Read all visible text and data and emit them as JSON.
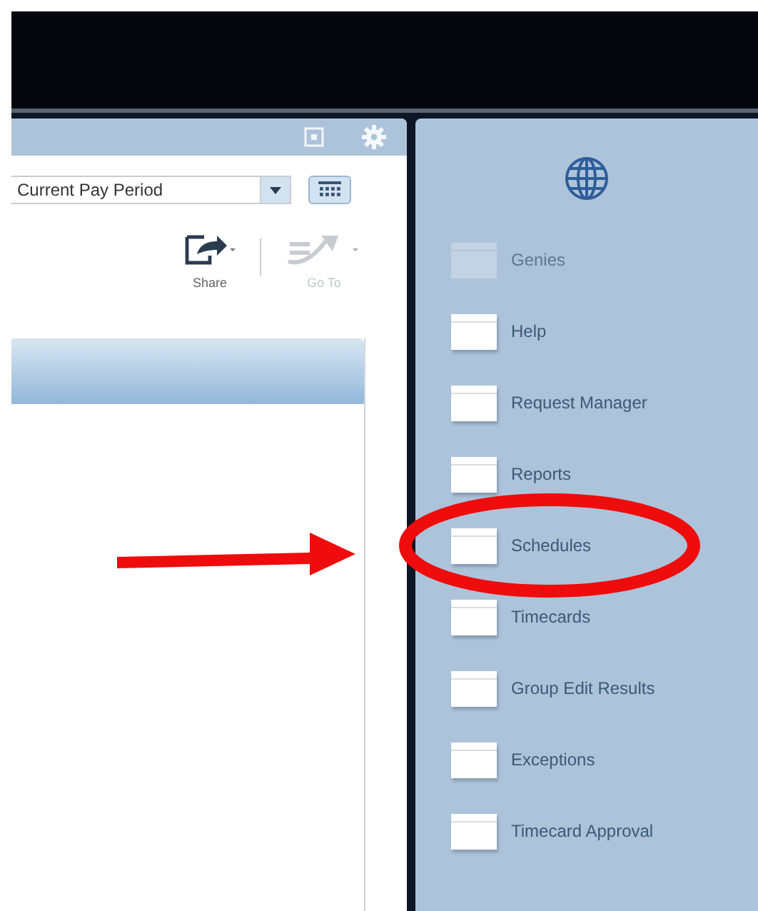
{
  "left_panel": {
    "period_select": {
      "value": "Current Pay Period"
    },
    "toolbar": [
      {
        "kind": "share",
        "label": "Share",
        "disabled": false
      },
      {
        "kind": "goto",
        "label": "Go To",
        "disabled": true
      }
    ]
  },
  "related_items": {
    "items": [
      {
        "label": "Genies",
        "disabled": true,
        "circled": false
      },
      {
        "label": "Help",
        "disabled": false,
        "circled": false
      },
      {
        "label": "Request Manager",
        "disabled": false,
        "circled": false
      },
      {
        "label": "Reports",
        "disabled": false,
        "circled": false
      },
      {
        "label": "Schedules",
        "disabled": false,
        "circled": true
      },
      {
        "label": "Timecards",
        "disabled": false,
        "circled": false
      },
      {
        "label": "Group Edit Results",
        "disabled": false,
        "circled": false
      },
      {
        "label": "Exceptions",
        "disabled": false,
        "circled": false
      },
      {
        "label": "Timecard Approval",
        "disabled": false,
        "circled": false
      }
    ]
  },
  "pointer_arrow": true
}
